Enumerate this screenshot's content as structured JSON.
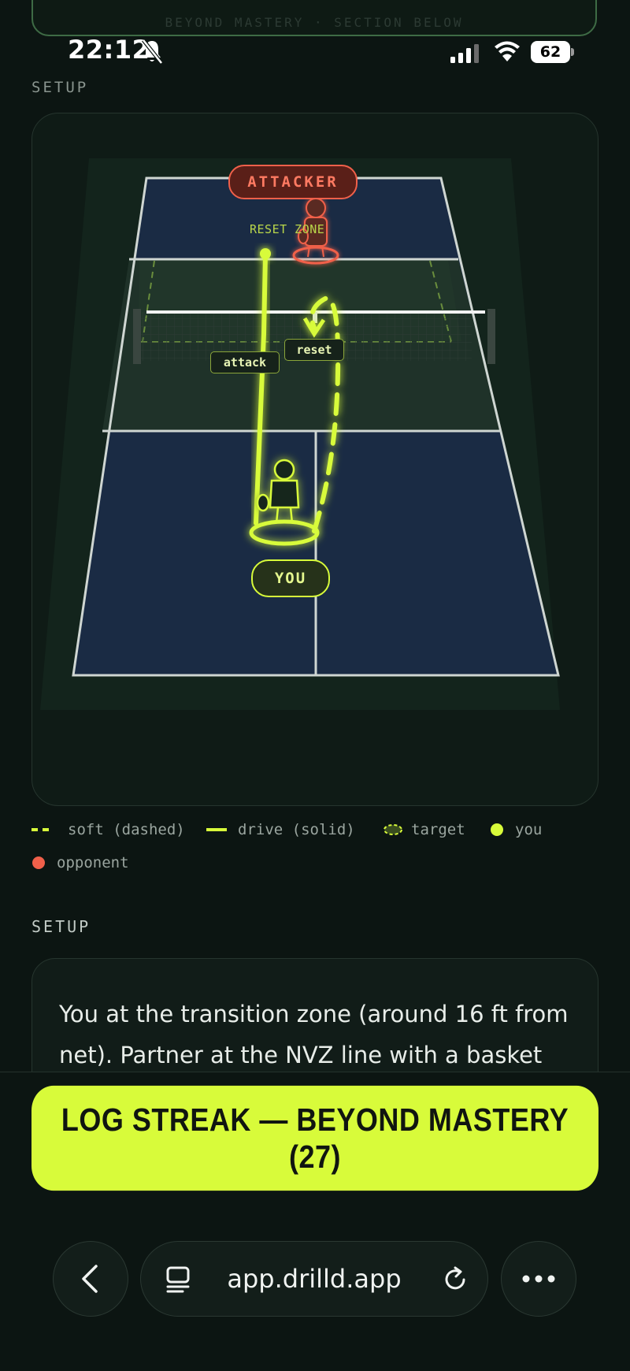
{
  "top_card": {
    "text": "BEYOND MASTERY · SECTION BELOW"
  },
  "status_bar": {
    "time": "22:12",
    "battery": "62"
  },
  "section_labels": {
    "diagram": "SETUP",
    "setup": "SETUP"
  },
  "court": {
    "attacker_label": "ATTACKER",
    "reset_zone_label": "RESET ZONE",
    "attack_label": "attack",
    "reset_label": "reset",
    "you_label": "YOU",
    "colors": {
      "you": "#d8fb3a",
      "opponent": "#f0604a",
      "court": "#1a2b44",
      "kitchen": "#1f3229"
    }
  },
  "legend": {
    "soft": "soft (dashed)",
    "drive": "drive (solid)",
    "target": "target",
    "you": "you",
    "opponent": "opponent"
  },
  "setup": {
    "text": "You at the transition zone (around 16 ft from net). Partner at the NVZ line with a basket"
  },
  "cta": {
    "label": "LOG STREAK — BEYOND MASTERY (27)"
  },
  "browser": {
    "url": "app.drilld.app",
    "icons": {
      "back": "chevron-left-icon",
      "tabs": "tabs-icon",
      "reload": "reload-icon",
      "more": "more-icon"
    }
  }
}
